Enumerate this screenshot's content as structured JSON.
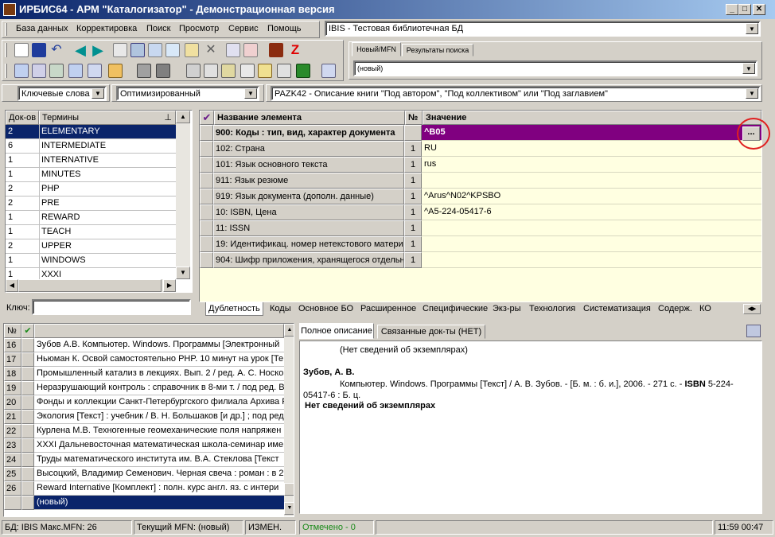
{
  "window": {
    "title": "ИРБИС64 - АРМ \"Каталогизатор\" - Демонстрационная версия"
  },
  "menu": [
    "База данных",
    "Корректировка",
    "Поиск",
    "Просмотр",
    "Сервис",
    "Помощь"
  ],
  "database_select": {
    "value": "IBIS - Тестовая библиотечная БД"
  },
  "top_tabs": [
    "Новый/MFN",
    "Результаты поиска"
  ],
  "new_mfn_select": {
    "value": "(новый)"
  },
  "filters": {
    "dictionary": "Ключевые слова",
    "mode": "Оптимизированный",
    "worksheet": "PAZK42 - Описание книги \"Под автором\", \"Под коллективом\" или \"Под заглавием\""
  },
  "terms": {
    "col_docs": "Док-ов",
    "col_terms": "Термины",
    "rows": [
      {
        "count": "2",
        "term": "ELEMENTARY"
      },
      {
        "count": "6",
        "term": "INTERMEDIATE"
      },
      {
        "count": "1",
        "term": "INTERNATIVE"
      },
      {
        "count": "1",
        "term": "MINUTES"
      },
      {
        "count": "2",
        "term": "PHP"
      },
      {
        "count": "2",
        "term": "PRE"
      },
      {
        "count": "1",
        "term": "REWARD"
      },
      {
        "count": "1",
        "term": "TEACH"
      },
      {
        "count": "2",
        "term": "UPPER"
      },
      {
        "count": "1",
        "term": "WINDOWS"
      },
      {
        "count": "1",
        "term": "XXXI"
      }
    ],
    "key_label": "Ключ:"
  },
  "elements": {
    "col_name": "Название элемента",
    "col_num": "№",
    "col_value": "Значение",
    "rows": [
      {
        "name": "900: Коды : тип, вид, характер документа",
        "num": "",
        "value": "^B05"
      },
      {
        "name": "102: Страна",
        "num": "1",
        "value": "RU"
      },
      {
        "name": "101: Язык основного текста",
        "num": "1",
        "value": "rus"
      },
      {
        "name": "911: Язык резюме",
        "num": "1",
        "value": ""
      },
      {
        "name": "919: Язык документа (дополн. данные)",
        "num": "1",
        "value": "^Arus^N02^KPSBO"
      },
      {
        "name": "10: ISBN, Цена",
        "num": "1",
        "value": "^A5-224-05417-6"
      },
      {
        "name": "11: ISSN",
        "num": "1",
        "value": ""
      },
      {
        "name": "19: Идентификац. номер нетекстового матери",
        "num": "1",
        "value": ""
      },
      {
        "name": "904: Шифр приложения, хранящегося отдельно",
        "num": "1",
        "value": ""
      }
    ],
    "ellipsis": "..."
  },
  "worksheet_tabs": [
    "Дублетность",
    "Коды",
    "Основное БО",
    "Расширенное",
    "Специфические",
    "Экз-ры",
    "Технология",
    "Систематизация",
    "Содерж.",
    "КО"
  ],
  "records": {
    "col_num": "№",
    "rows": [
      {
        "n": "16",
        "text": "Зубов А.В. Компьютер. Windows. Программы [Электронный"
      },
      {
        "n": "17",
        "text": "Ньюман К. Освой самостоятельно PHP. 10 минут на урок [Те"
      },
      {
        "n": "18",
        "text": "Промышленный катализ в лекциях. Вып. 2 / ред. А. С. Носко"
      },
      {
        "n": "19",
        "text": "Неразрушающий контроль : справочник в 8-ми т. / под ред. В"
      },
      {
        "n": "20",
        "text": "Фонды и коллекции Санкт-Петербургского филиала Архива Р"
      },
      {
        "n": "21",
        "text": "Экология [Текст] : учебник / В. Н. Большаков [и др.] ; под ред"
      },
      {
        "n": "22",
        "text": "Курлена М.В. Техногенные геомеханические поля напряжен"
      },
      {
        "n": "23",
        "text": "XXXI Дальневосточная математическая школа-семинар име"
      },
      {
        "n": "24",
        "text": "Труды математического института им. В.А. Стеклова [Текст"
      },
      {
        "n": "25",
        "text": "Высоцкий, Владимир Семенович. Черная свеча : роман : в 2"
      },
      {
        "n": "26",
        "text": "Reward Internative [Комплект] : полн. курс англ. яз. с интери"
      }
    ],
    "new_row": "(новый)"
  },
  "desc_tabs": [
    "Полное описание",
    "Связанные док-ты (НЕТ)"
  ],
  "description": {
    "no_copies_1": "(Нет сведений об экземплярах)",
    "author": "Зубов, А. В.",
    "body_pre": "Компьютер. Windows. Программы [Текст] / А. В. Зубов. - [Б. м. : б. и.], 2006. - 271 с. - ",
    "isbn_label": "ISBN",
    "body_post": " 5-224-05417-6 : Б. ц.",
    "no_copies_2": "Нет сведений об экземплярах"
  },
  "status": {
    "db": "БД: IBIS Макс.MFN: 26",
    "current": "Текущий MFN: (новый)",
    "changed": "ИЗМЕН.",
    "marked": "Отмечено - 0",
    "time": "11:59  00:47"
  }
}
